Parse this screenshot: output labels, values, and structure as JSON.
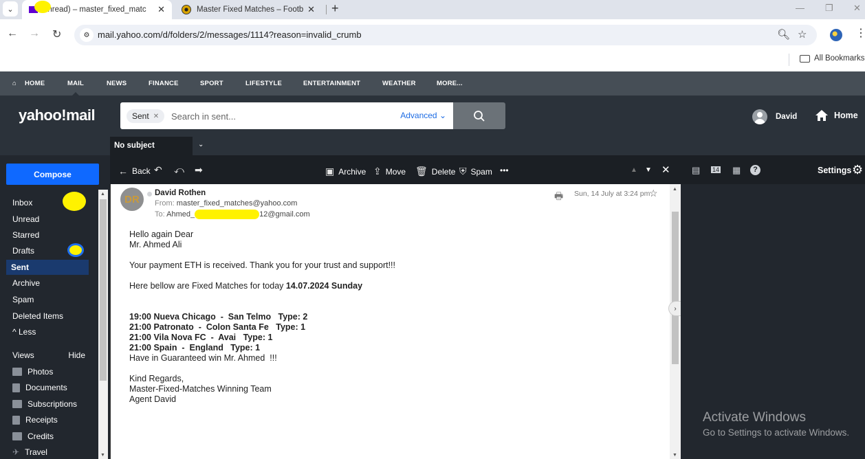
{
  "browser": {
    "tabs": [
      {
        "title": "unread) – master_fixed_matc",
        "active": true,
        "favicon": "yahoo-mail-envelope"
      },
      {
        "title": "Master Fixed Matches – Footbal",
        "active": false,
        "favicon": "soccer-ball"
      }
    ],
    "new_tab_label": "+",
    "url": "mail.yahoo.com/d/folders/2/messages/1114?reason=invalid_crumb",
    "bookmarks_label": "All Bookmarks",
    "window_controls": {
      "minimize": "—",
      "restore": "❐",
      "close": "✕"
    }
  },
  "yahoo_nav": {
    "items": [
      "HOME",
      "MAIL",
      "NEWS",
      "FINANCE",
      "SPORT",
      "LIFESTYLE",
      "ENTERTAINMENT",
      "WEATHER",
      "MORE..."
    ],
    "active": "MAIL"
  },
  "header": {
    "logo": "yahoo!mail",
    "search": {
      "chip": "Sent",
      "placeholder": "Search in sent...",
      "value": "",
      "advanced_label": "Advanced"
    },
    "user_name": "David",
    "home_label": "Home"
  },
  "subject_tab": {
    "label": "No subject"
  },
  "sidebar": {
    "compose_label": "Compose",
    "folders": [
      {
        "label": "Inbox",
        "active": false
      },
      {
        "label": "Unread",
        "active": false
      },
      {
        "label": "Starred",
        "active": false
      },
      {
        "label": "Drafts",
        "active": false
      },
      {
        "label": "Sent",
        "active": true
      },
      {
        "label": "Archive",
        "active": false
      },
      {
        "label": "Spam",
        "active": false
      },
      {
        "label": "Deleted Items",
        "active": false
      }
    ],
    "less_label": "^ Less",
    "views_label": "Views",
    "hide_label": "Hide",
    "views": [
      {
        "label": "Photos",
        "icon": "photo-icon"
      },
      {
        "label": "Documents",
        "icon": "document-icon"
      },
      {
        "label": "Subscriptions",
        "icon": "subscriptions-icon"
      },
      {
        "label": "Receipts",
        "icon": "receipt-icon"
      },
      {
        "label": "Credits",
        "icon": "credit-card-icon"
      },
      {
        "label": "Travel",
        "icon": "airplane-icon"
      }
    ]
  },
  "message_toolbar": {
    "back": "Back",
    "archive": "Archive",
    "move": "Move",
    "delete": "Delete",
    "spam": "Spam",
    "more": "•••"
  },
  "right_toolbar": {
    "settings_label": "Settings",
    "calendar_day": "14"
  },
  "message": {
    "sender_initials": "DR",
    "sender_name": "David Rothen",
    "from_label": "From:",
    "from_address": "master_fixed_matches@yahoo.com",
    "to_label": "To:",
    "to_prefix": "Ahmed_",
    "to_suffix": "12@gmail.com",
    "date": "Sun, 14 July at 3:24 pm",
    "body": {
      "greeting_1": "Hello again Dear",
      "greeting_2": "Mr. Ahmed Ali",
      "payment_line": "Your payment ETH is received. Thank you for your trust and support!!!",
      "intro": "Here bellow are Fixed Matches for today ",
      "intro_bold": "14.07.2024 Sunday",
      "matches": [
        "19:00 Nueva Chicago  -  San Telmo   Type: 2",
        "21:00 Patronato  -  Colon Santa Fe   Type: 1",
        "21:00 Vila Nova FC  -  Avai   Type: 1",
        "21:00 Spain  -  England   Type: 1"
      ],
      "guarantee": "Have in Guaranteed win Mr. Ahmed  !!!",
      "regards": "Kind Regards,",
      "team": "Master-Fixed-Matches Winning Team",
      "agent": "Agent David"
    }
  },
  "watermark": {
    "title": "Activate Windows",
    "subtitle": "Go to Settings to activate Windows."
  }
}
